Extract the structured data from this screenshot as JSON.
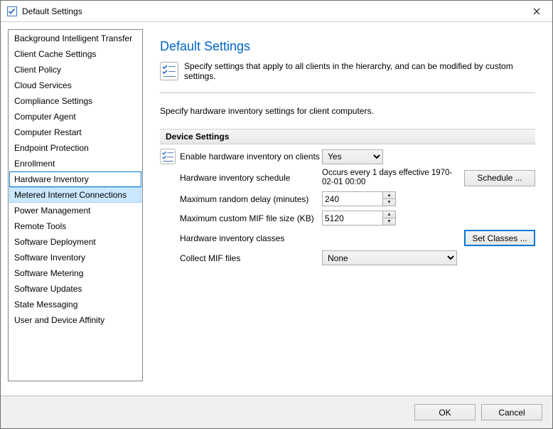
{
  "window": {
    "title": "Default Settings"
  },
  "sidebar": {
    "items": [
      {
        "label": "Background Intelligent Transfer"
      },
      {
        "label": "Client Cache Settings"
      },
      {
        "label": "Client Policy"
      },
      {
        "label": "Cloud Services"
      },
      {
        "label": "Compliance Settings"
      },
      {
        "label": "Computer Agent"
      },
      {
        "label": "Computer Restart"
      },
      {
        "label": "Endpoint Protection"
      },
      {
        "label": "Enrollment"
      },
      {
        "label": "Hardware Inventory"
      },
      {
        "label": "Metered Internet Connections"
      },
      {
        "label": "Power Management"
      },
      {
        "label": "Remote Tools"
      },
      {
        "label": "Software Deployment"
      },
      {
        "label": "Software Inventory"
      },
      {
        "label": "Software Metering"
      },
      {
        "label": "Software Updates"
      },
      {
        "label": "State Messaging"
      },
      {
        "label": "User and Device Affinity"
      }
    ],
    "activeIndex": 9,
    "hoverIndex": 10
  },
  "main": {
    "heading": "Default Settings",
    "description": "Specify settings that apply to all clients in the hierarchy, and can be modified by custom settings.",
    "sub_description": "Specify hardware inventory settings for client computers.",
    "section_label": "Device Settings",
    "rows": {
      "enable_label": "Enable hardware inventory on clients",
      "enable_value": "Yes",
      "schedule_label": "Hardware inventory schedule",
      "schedule_value": "Occurs every 1 days effective 1970-02-01 00:00",
      "schedule_button": "Schedule ...",
      "delay_label": "Maximum random delay (minutes)",
      "delay_value": "240",
      "mifsize_label": "Maximum custom MIF file size (KB)",
      "mifsize_value": "5120",
      "classes_label": "Hardware inventory classes",
      "classes_button": "Set Classes ...",
      "collect_label": "Collect MIF files",
      "collect_value": "None"
    }
  },
  "footer": {
    "ok": "OK",
    "cancel": "Cancel"
  }
}
